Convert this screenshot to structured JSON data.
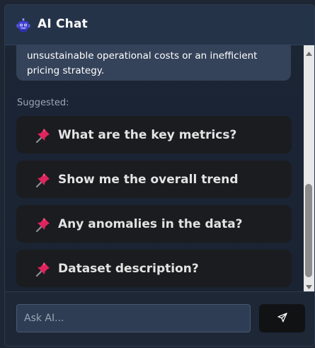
{
  "header": {
    "title": "AI Chat",
    "logo_icon": "robot-logo-icon"
  },
  "messages": [
    {
      "role": "assistant",
      "text": "unsustainable operational costs or an inefficient pricing strategy."
    }
  ],
  "suggested": {
    "label": "Suggested:",
    "items": [
      {
        "icon": "pushpin-icon",
        "label": "What are the key metrics?"
      },
      {
        "icon": "pushpin-icon",
        "label": "Show me the overall trend"
      },
      {
        "icon": "pushpin-icon",
        "label": "Any anomalies in the data?"
      },
      {
        "icon": "pushpin-icon",
        "label": "Dataset description?"
      }
    ]
  },
  "composer": {
    "placeholder": "Ask AI...",
    "value": "",
    "send_icon": "send-icon"
  },
  "colors": {
    "header_bg": "#253349",
    "bubble_bg": "#34435a",
    "suggestion_bg": "#1b1c1f",
    "pin_red": "#e0245e"
  }
}
